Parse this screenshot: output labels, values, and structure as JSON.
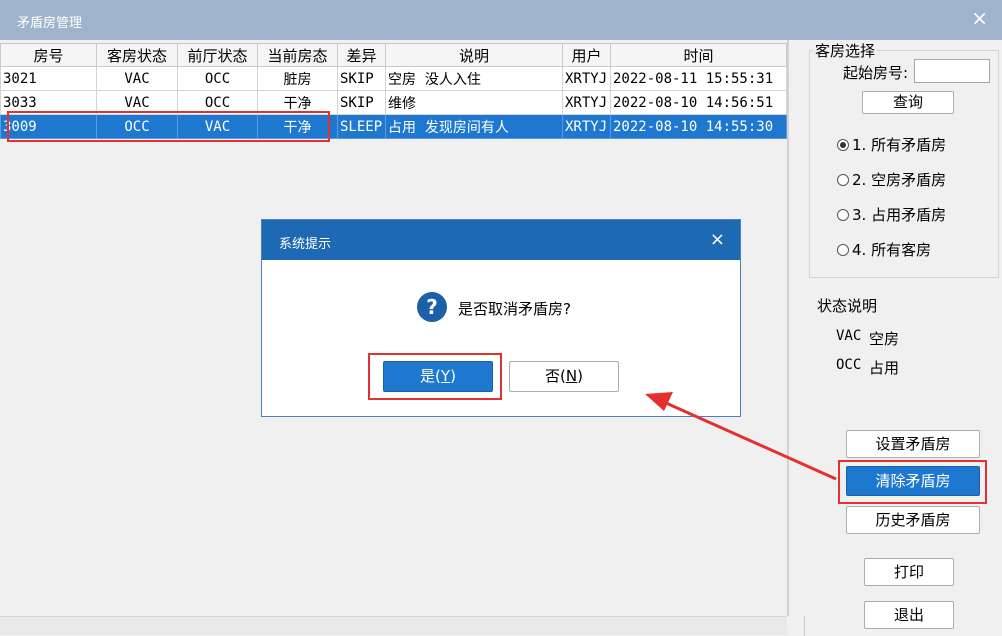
{
  "window": {
    "title": "矛盾房管理",
    "close_icon": "×"
  },
  "table": {
    "columns": [
      "房号",
      "客房状态",
      "前厅状态",
      "当前房态",
      "差异",
      "说明",
      "用户",
      "时间"
    ],
    "rows": [
      {
        "room": "3021",
        "room_status": "VAC",
        "front_status": "OCC",
        "current": "脏房",
        "diff": "SKIP",
        "note": "空房  没人入住",
        "user": "XRTYJ",
        "time": "2022-08-11 15:55:31",
        "selected": false
      },
      {
        "room": "3033",
        "room_status": "VAC",
        "front_status": "OCC",
        "current": "干净",
        "diff": "SKIP",
        "note": "维修",
        "user": "XRTYJ",
        "time": "2022-08-10 14:56:51",
        "selected": false
      },
      {
        "room": "3009",
        "room_status": "OCC",
        "front_status": "VAC",
        "current": "干净",
        "diff": "SLEEP",
        "note": "占用  发现房间有人",
        "user": "XRTYJ",
        "time": "2022-08-10 14:55:30",
        "selected": true
      }
    ]
  },
  "panel": {
    "group_title": "客房选择",
    "start_room_label": "起始房号:",
    "start_room_value": "",
    "query_button": "查询",
    "radios": [
      {
        "label": "1. 所有矛盾房",
        "checked": true
      },
      {
        "label": "2. 空房矛盾房",
        "checked": false
      },
      {
        "label": "3. 占用矛盾房",
        "checked": false
      },
      {
        "label": "4. 所有客房",
        "checked": false
      }
    ],
    "status_title": "状态说明",
    "status_vac_code": "VAC",
    "status_vac_text": "空房",
    "status_occ_code": "OCC",
    "status_occ_text": "占用",
    "buttons": {
      "set": "设置矛盾房",
      "clear": "清除矛盾房",
      "history": "历史矛盾房",
      "print": "打印",
      "exit": "退出"
    }
  },
  "dialog": {
    "title": "系统提示",
    "close_icon": "×",
    "icon": "question-icon",
    "message": "是否取消矛盾房?",
    "yes_text": "是(",
    "yes_key": "Y",
    "yes_end": ")",
    "no_text": "否(",
    "no_key": "N",
    "no_end": ")"
  },
  "colors": {
    "titlebar": "#9fb4cc",
    "dialog_title": "#1e69b4",
    "selection": "#1e78cf",
    "annotation": "#e53030"
  }
}
